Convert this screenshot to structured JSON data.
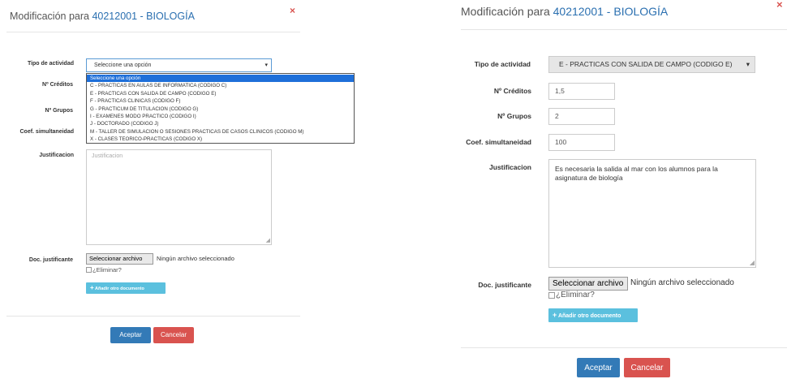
{
  "dialog": {
    "title_prefix": "Modificación para",
    "title_code": "40212001 - BIOLOGÍA",
    "close_symbol": "×"
  },
  "labels": {
    "activity": "Tipo de actividad",
    "credits": "Nº Créditos",
    "groups": "Nº Grupos",
    "coef": "Coef. simultaneidad",
    "justification": "Justificacion",
    "doc": "Doc. justificante"
  },
  "left": {
    "activity_value": "Seleccione una opción",
    "justification_placeholder": "Justificacion",
    "options": [
      "Seleccione una opción",
      "C - PRACTICAS EN AULAS DE INFORMATICA (CODIGO C)",
      "E - PRACTICAS CON SALIDA DE CAMPO (CODIGO E)",
      "F - PRACTICAS CLINICAS (CODIGO F)",
      "G - PRACTICUM DE TITULACION (CODIGO G)",
      "I - EXAMENES MODO PRACTICO (CODIGO I)",
      "J - DOCTORADO (CODIGO J)",
      "M - TALLER DE SIMULACION O SESIONES PRACTICAS DE CASOS CLINICOS (CODIGO M)",
      "X - CLASES TEORICO-PRACTICAS (CODIGO X)"
    ]
  },
  "right": {
    "activity_value": "E - PRACTICAS CON SALIDA DE CAMPO (CODIGO E)",
    "credits": "1,5",
    "groups": "2",
    "coef": "100",
    "justification": "Es necesaria la salida al mar con los alumnos para la asignatura de biología"
  },
  "file": {
    "button": "Seleccionar archivo",
    "status": "Ningún archivo seleccionado",
    "delete_label": "¿Eliminar?",
    "add_doc": "Añadir otro documento",
    "add_icon": "plus-icon"
  },
  "actions": {
    "accept": "Aceptar",
    "cancel": "Cancelar"
  },
  "colors": {
    "primary": "#337ab7",
    "danger": "#d9534f",
    "info": "#5bc0de",
    "link": "#2a6fb0"
  }
}
